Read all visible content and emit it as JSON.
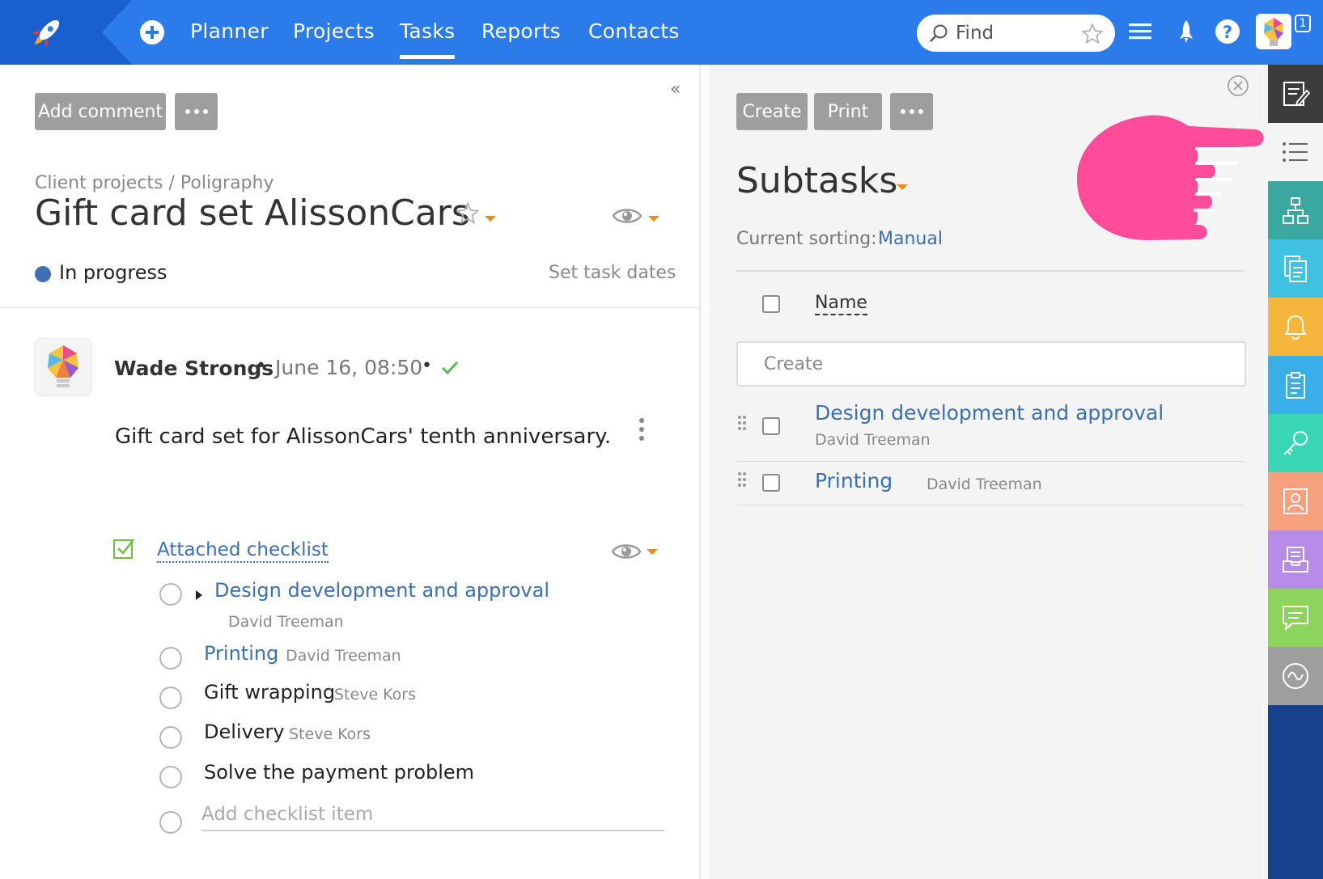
{
  "topbar": {
    "nav": [
      "Planner",
      "Projects",
      "Tasks",
      "Reports",
      "Contacts"
    ],
    "active_nav": "Tasks",
    "search_placeholder": "Find",
    "notification_count": "1",
    "bg_color": "#2b7bea"
  },
  "left": {
    "add_comment_label": "Add comment",
    "breadcrumb": "Client projects / Poligraphy",
    "title": "Gift card set AlissonCars",
    "status": "In progress",
    "status_color": "#3f6fb5",
    "set_dates_label": "Set task dates",
    "comment": {
      "author": "Wade Strongs",
      "date": "June 16, 08:50",
      "text": "Gift card set for AlissonCars' tenth anniversary."
    },
    "checklist": {
      "title": "Attached checklist",
      "items": [
        {
          "label": "Design development and approval",
          "assignee": "David Treeman",
          "is_link": true
        },
        {
          "label": "Printing",
          "assignee": "David Treeman",
          "is_link": true
        },
        {
          "label": "Gift wrapping",
          "assignee": "Steve Kors",
          "is_link": false
        },
        {
          "label": "Delivery",
          "assignee": "Steve Kors",
          "is_link": false
        },
        {
          "label": "Solve the payment problem",
          "assignee": "",
          "is_link": false
        }
      ],
      "add_placeholder": "Add checklist item"
    }
  },
  "right": {
    "create_label": "Create",
    "print_label": "Print",
    "title": "Subtasks",
    "sorting_label": "Current sorting:",
    "sorting_value": "Manual",
    "name_header": "Name",
    "create_placeholder": "Create",
    "subtasks": [
      {
        "label": "Design development and approval",
        "assignee": "David Treeman"
      },
      {
        "label": "Printing",
        "assignee": "David Treeman"
      }
    ]
  },
  "strip": {
    "items": [
      {
        "icon": "edit-note-icon",
        "color": "#3c3c3c"
      },
      {
        "icon": "list-icon",
        "color": "#f4f4f4"
      },
      {
        "icon": "hierarchy-icon",
        "color": "#3aa7a0"
      },
      {
        "icon": "documents-icon",
        "color": "#3fc1e0"
      },
      {
        "icon": "bell-icon",
        "color": "#f6b53c"
      },
      {
        "icon": "clipboard-icon",
        "color": "#3aaee8"
      },
      {
        "icon": "key-icon",
        "color": "#38d6b4"
      },
      {
        "icon": "contact-card-icon",
        "color": "#f7a07d"
      },
      {
        "icon": "inbox-icon",
        "color": "#b78be8"
      },
      {
        "icon": "chat-icon",
        "color": "#8dd45c"
      },
      {
        "icon": "activity-icon",
        "color": "#9e9e9e"
      }
    ]
  }
}
